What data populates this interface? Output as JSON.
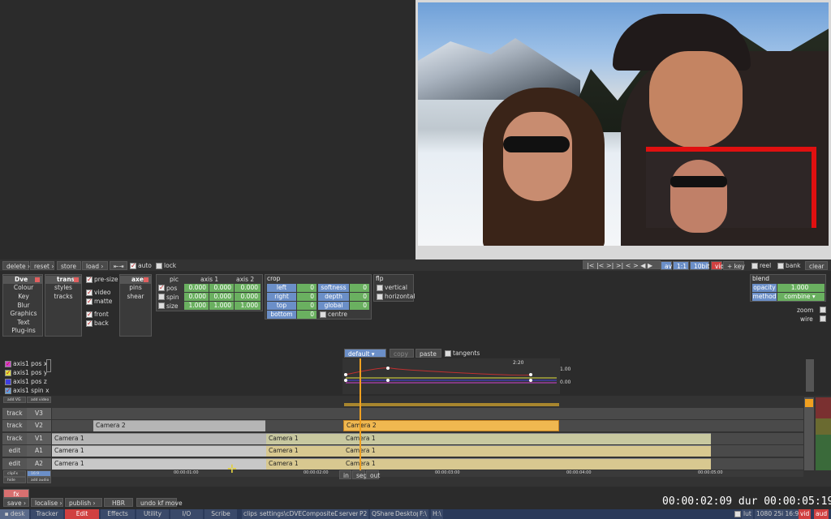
{
  "toolbar": {
    "delete": "delete",
    "reset": "reset",
    "store": "store",
    "load": "load",
    "auto": "auto",
    "lock": "lock"
  },
  "viewer_controls": {
    "transport": "|< |< >| >| < > ◀ ▶",
    "av": "av",
    "ratio": "1:1",
    "bits": "10bit",
    "vid": "vid",
    "key": "+ key",
    "reel": "reel",
    "bank": "bank",
    "clear": "clear"
  },
  "dve_menu": {
    "head": "Dve",
    "items": [
      "Colour",
      "Key",
      "Blur",
      "Graphics",
      "Text",
      "Plug-ins"
    ]
  },
  "trans_menu": {
    "head": "trans",
    "items": [
      "styles",
      "tracks"
    ]
  },
  "options": {
    "pre_size": "pre-size",
    "video": "video",
    "matte": "matte",
    "front": "front",
    "back": "back"
  },
  "axes_menu": {
    "head": "axes",
    "items": [
      "pins",
      "shear"
    ]
  },
  "pic_panel": {
    "headers": [
      "pic",
      "axis 1",
      "axis 2"
    ],
    "rows": [
      {
        "label": "pos",
        "a1": "0.000",
        "a2": "0.000",
        "a3": "0.000"
      },
      {
        "label": "spin",
        "a1": "0.000",
        "a2": "0.000",
        "a3": "0.000"
      },
      {
        "label": "size",
        "a1": "1.000",
        "a2": "1.000",
        "a3": "1.000"
      }
    ]
  },
  "crop_panel": {
    "title": "crop",
    "left": {
      "label": "left",
      "value": "0"
    },
    "right": {
      "label": "right",
      "value": "0"
    },
    "top": {
      "label": "top",
      "value": "0"
    },
    "bottom": {
      "label": "bottom",
      "value": "0"
    },
    "softness": {
      "label": "softness",
      "value": "0"
    },
    "depth": {
      "label": "depth",
      "value": "0"
    },
    "global": {
      "label": "global",
      "value": "0"
    },
    "centre": "centre"
  },
  "flip_panel": {
    "title": "flp",
    "vertical": "vertical",
    "horizontal": "horizontal"
  },
  "blend_panel": {
    "title": "blend",
    "opacity_label": "opacity",
    "opacity_value": "1.000",
    "method_label": "method",
    "method_value": "combine",
    "zoom": "zoom",
    "wire": "wire"
  },
  "graph": {
    "preset": "default",
    "copy": "copy",
    "paste": "paste",
    "tangents": "tangents",
    "channels": [
      {
        "label": "axis1 pos x",
        "color": "#d040d0"
      },
      {
        "label": "axis1 pos y",
        "color": "#e0e040"
      },
      {
        "label": "axis1 pos z",
        "color": "#4040e0"
      },
      {
        "label": "axis1 spin x",
        "color": "#60a0e0"
      }
    ],
    "top_label": "2:20",
    "val_top": "1.00",
    "val_bottom": "0.00"
  },
  "track_buttons": {
    "add_vid": "add VG",
    "add_video": "add video",
    "clipfx": "clipFx",
    "scale": "16:9",
    "hide": "hide",
    "add_audio": "add audio"
  },
  "tracks": [
    {
      "label": "track",
      "name": "V3"
    },
    {
      "label": "track",
      "name": "V2"
    },
    {
      "label": "track",
      "name": "V1"
    },
    {
      "label": "edit",
      "name": "A1"
    },
    {
      "label": "edit",
      "name": "A2"
    }
  ],
  "clips": {
    "camera2": "Camera 2",
    "camera1": "Camera 1"
  },
  "timeline": {
    "ticks": [
      "00:00:01:00",
      "00:00:02:00",
      "00:00:03:00",
      "00:00:04:00",
      "00:00:05:00"
    ],
    "in": "in",
    "seg": "seg",
    "out": "out"
  },
  "action_bar": {
    "fx": "fx",
    "save": "save",
    "localise": "localise",
    "publish": "publish",
    "hbr": "HBR",
    "undo": "undo kf move"
  },
  "timecode": "00:00:02:09 dur 00:00:05:19",
  "bottom_tabs": [
    "desk",
    "Tracker",
    "Edit",
    "Effects",
    "Utility",
    "I/O",
    "Scribe"
  ],
  "status_items": [
    "clips",
    "settings\\cDVECompositeData",
    "server",
    "P2",
    "QShare",
    "Desktop",
    "F:\\",
    "H:\\"
  ],
  "status_right": {
    "lut": "lut",
    "format": "1080 25i 16:9",
    "vid": "vid",
    "aud": "aud"
  }
}
